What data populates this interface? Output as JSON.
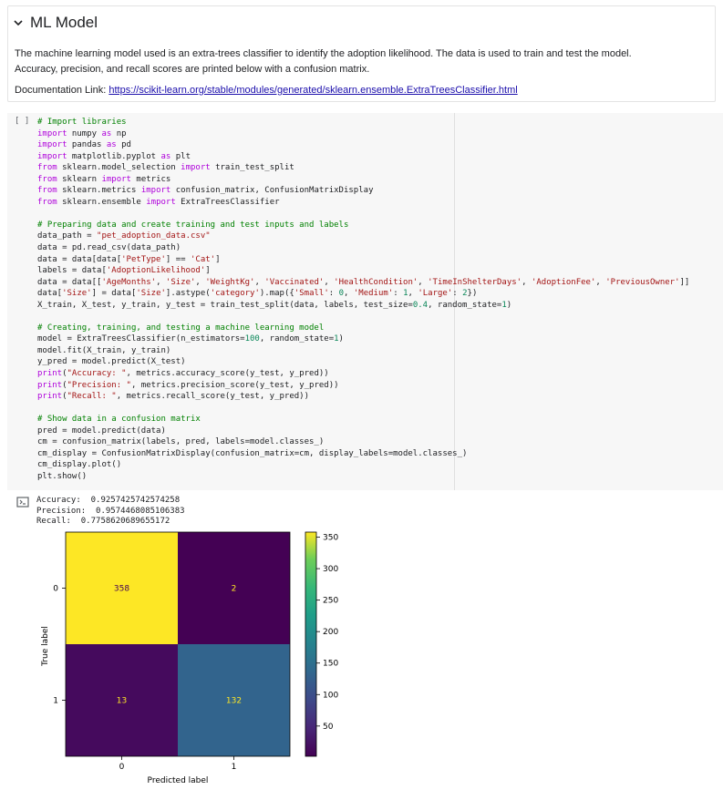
{
  "section": {
    "title": "ML Model",
    "paragraph_line1": "The machine learning model used is an extra-trees classifier to identify the adoption likelihood. The data is used to train and test the model.",
    "paragraph_line2": "Accuracy, precision, and recall scores are printed below with a confusion matrix.",
    "doc_label": "Documentation Link: ",
    "doc_link": "https://scikit-learn.org/stable/modules/generated/sklearn.ensemble.ExtraTreesClassifier.html"
  },
  "code_cell": {
    "run_label": "[ ]"
  },
  "output": {
    "lines": [
      "Accuracy:  0.9257425742574258",
      "Precision:  0.9574468085106383",
      "Recall:  0.7758620689655172"
    ]
  },
  "chart_data": {
    "type": "heatmap",
    "xlabel": "Predicted label",
    "ylabel": "True label",
    "x_ticks": [
      "0",
      "1"
    ],
    "y_ticks": [
      "0",
      "1"
    ],
    "matrix": [
      [
        358,
        2
      ],
      [
        13,
        132
      ]
    ],
    "colorbar": {
      "ticks": [
        50,
        100,
        150,
        200,
        250,
        300,
        350
      ],
      "min": 2,
      "max": 358
    },
    "colormap": "viridis",
    "colors": {
      "high": "#fde725",
      "low": "#440154",
      "mid": "#21918c"
    }
  }
}
